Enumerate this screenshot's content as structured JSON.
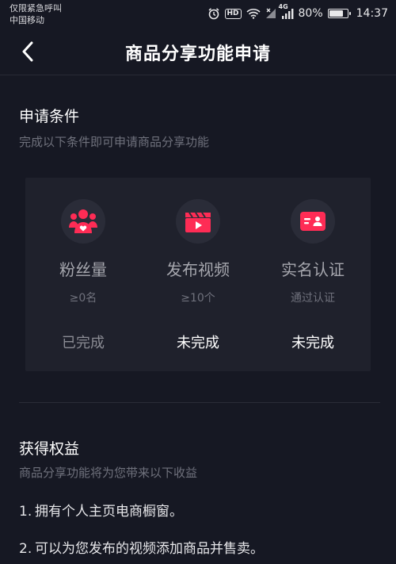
{
  "status_bar": {
    "carrier_line1": "仅限紧急呼叫",
    "carrier_line2": "中国移动",
    "hd": "HD",
    "network": "4G",
    "battery": "80%",
    "battery_level": 0.8,
    "time": "14:37"
  },
  "nav": {
    "title": "商品分享功能申请"
  },
  "conditions": {
    "title": "申请条件",
    "subtitle": "完成以下条件即可申请商品分享功能",
    "accent_color": "#fe2c55",
    "items": [
      {
        "icon": "fans-icon",
        "label": "粉丝量",
        "requirement": "≥0名",
        "status": "已完成"
      },
      {
        "icon": "video-icon",
        "label": "发布视频",
        "requirement": "≥10个",
        "status": "未完成"
      },
      {
        "icon": "id-card-icon",
        "label": "实名认证",
        "requirement": "通过认证",
        "status": "未完成"
      }
    ]
  },
  "benefits": {
    "title": "获得权益",
    "subtitle": "商品分享功能将为您带来以下收益",
    "items": [
      {
        "num": "1.",
        "text": "拥有个人主页电商橱窗。"
      },
      {
        "num": "2.",
        "text": "可以为您发布的视频添加商品并售卖。"
      }
    ]
  }
}
